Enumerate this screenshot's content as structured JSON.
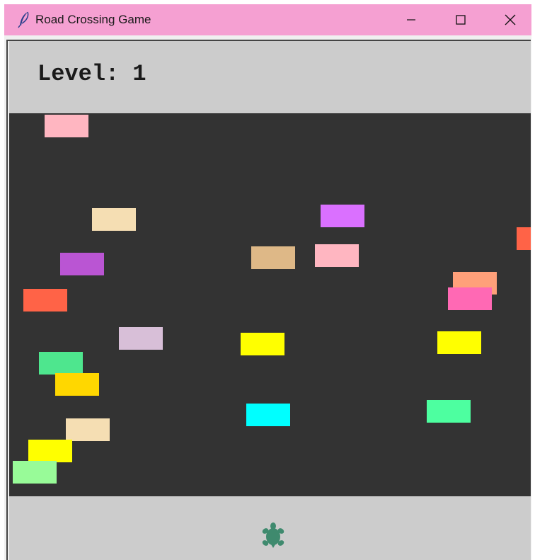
{
  "window": {
    "title": "Road Crossing Game",
    "app_icon": "feather-icon",
    "controls": [
      "minimize-icon",
      "maximize-icon",
      "close-icon"
    ],
    "titlebar_color": "#f5a0d2"
  },
  "game": {
    "level_text": "Level: 1",
    "player_icon": "turtle-icon",
    "player_color": "#3f8a6e",
    "background_color": "#cccccc",
    "road_color": "#333333",
    "cars": [
      {
        "color": "#ffb6c1"
      },
      {
        "color": "#f5deb3"
      },
      {
        "color": "#da70ff"
      },
      {
        "color": "#ba55d3"
      },
      {
        "color": "#deb887"
      },
      {
        "color": "#ffb6c1"
      },
      {
        "color": "#ff6347"
      },
      {
        "color": "#ffa07a"
      },
      {
        "color": "#ff69b4"
      },
      {
        "color": "#ff6347"
      },
      {
        "color": "#d8bfd8"
      },
      {
        "color": "#ffff00"
      },
      {
        "color": "#ffff00"
      },
      {
        "color": "#4ee68e"
      },
      {
        "color": "#ffd700"
      },
      {
        "color": "#00ffff"
      },
      {
        "color": "#4dffa0"
      },
      {
        "color": "#f5deb3"
      },
      {
        "color": "#ffff00"
      },
      {
        "color": "#98fb98"
      }
    ]
  }
}
